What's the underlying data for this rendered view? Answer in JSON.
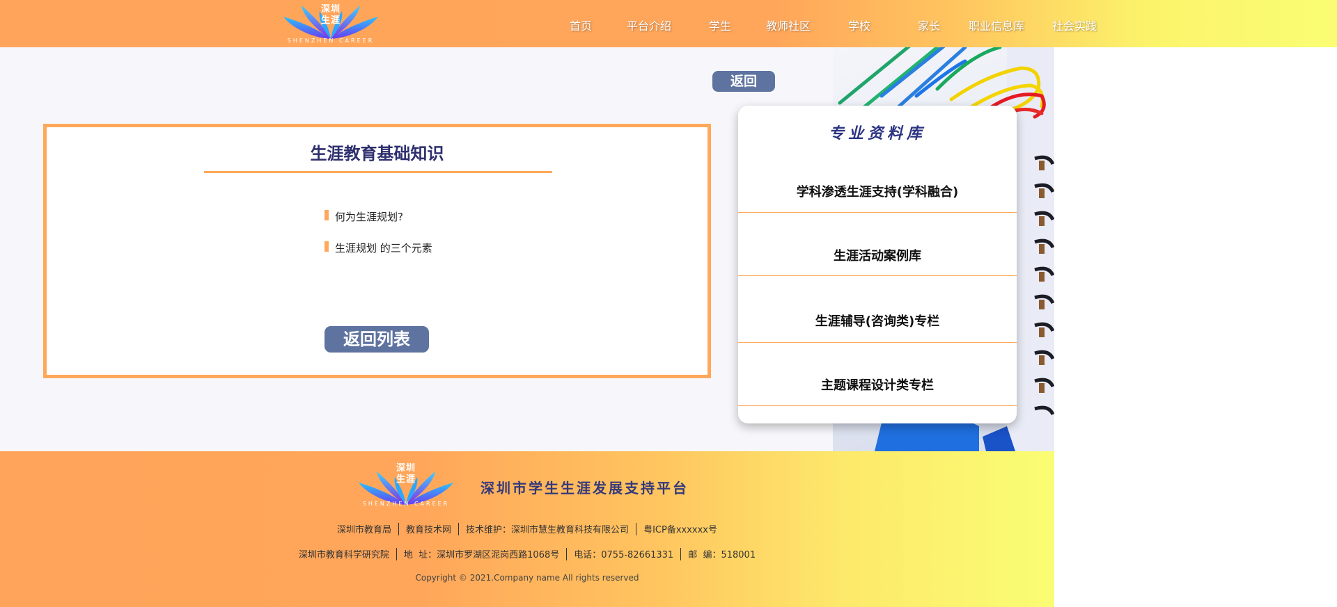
{
  "header": {
    "logo_text": "深圳\n生涯",
    "logo_subtext": "SHENZHEN CAREER",
    "nav": [
      {
        "label": "首页"
      },
      {
        "label": "平台介绍"
      },
      {
        "label": "学生"
      },
      {
        "label": "教师社区"
      },
      {
        "label": "学校"
      },
      {
        "label": "家长"
      },
      {
        "label": "职业信息库"
      },
      {
        "label": "社会实践"
      }
    ]
  },
  "main": {
    "back_button": "返回",
    "article": {
      "title": "生涯教育基础知识",
      "items": [
        {
          "text": "何为生涯规划?"
        },
        {
          "text": "生涯规划 的三个元素"
        }
      ],
      "back_list_button": "返回列表"
    },
    "panel": {
      "title": "专业资料库",
      "rows": [
        {
          "label": "学科渗透生涯支持(学科融合)"
        },
        {
          "label": "生涯活动案例库"
        },
        {
          "label": "生涯辅导(咨询类)专栏"
        },
        {
          "label": "主题课程设计类专栏"
        }
      ]
    }
  },
  "footer": {
    "logo_text": "深圳\n生涯",
    "logo_subtext": "SHENZHEN CAREER",
    "title": "深圳市学生生涯发展支持平台",
    "row1": [
      "深圳市教育局",
      "教育技术网",
      "技术维护：深圳市慧生教育科技有限公司",
      "粤ICP备xxxxxx号"
    ],
    "row2": [
      "深圳市教育科学研究院",
      "地  址：深圳市罗湖区泥岗西路1068号",
      "电话：0755-82661331",
      "邮  编：518001"
    ],
    "copyright": "Copyright © 2021.Company name All rights reserved"
  },
  "colors": {
    "accent_orange": "#ffa85a",
    "button_blue": "#5e739f",
    "title_navy": "#2e2f6e"
  }
}
